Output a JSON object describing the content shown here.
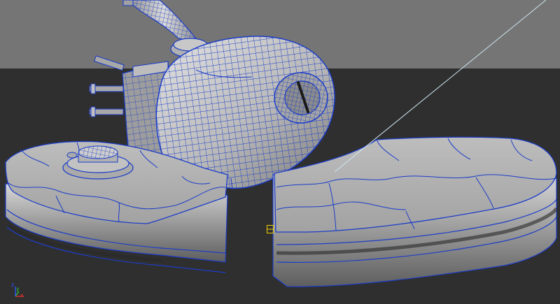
{
  "viewport": {
    "name": "perspective-viewport",
    "colors": {
      "background_upper": "#757575",
      "background_lower": "#2f2f2f",
      "surface_light": "#cfcfcf",
      "surface_mid": "#a8a8a8",
      "surface_dark": "#6f6f6f",
      "wire": "#1c3dc8",
      "wire_light": "#3a5ce8",
      "selection_line": "#cfe6f2",
      "pivot": "#f0d000"
    }
  },
  "axis_gizmo": {
    "x_label": "x",
    "y_label": "y",
    "z_label": "z",
    "x_color": "#e03030",
    "y_color": "#30c030",
    "z_color": "#3050ff"
  },
  "model": {
    "parts": [
      "neck-pipe",
      "head-sphere",
      "eye-socket",
      "side-engine",
      "left-platform-half",
      "right-platform-half",
      "top-cap"
    ]
  }
}
